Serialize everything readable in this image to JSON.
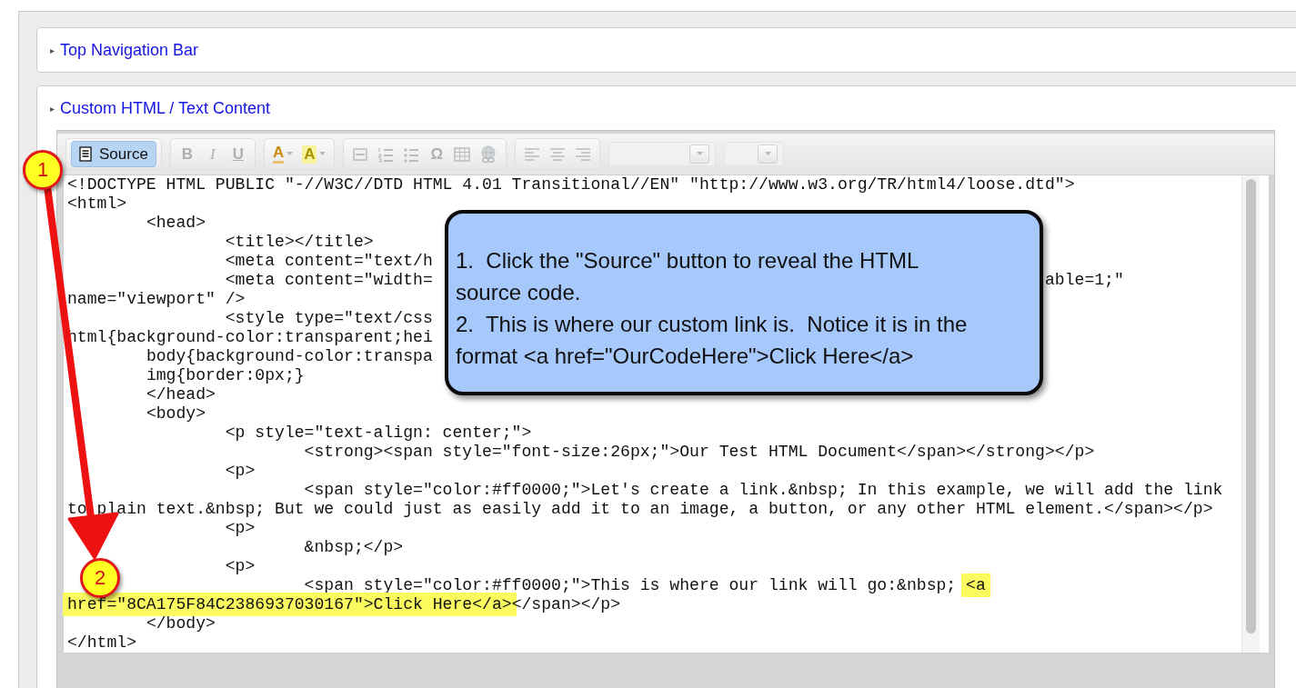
{
  "panels": [
    {
      "title": "Top Navigation Bar",
      "expander": "▸"
    },
    {
      "title": "Custom HTML / Text Content",
      "expander": "▸"
    }
  ],
  "editor": {
    "toolbar": [
      [
        {
          "kind": "source",
          "label": "Source",
          "on": true,
          "disabled": false
        }
      ],
      [
        {
          "kind": "bold",
          "label": "B",
          "on": false,
          "disabled": true
        },
        {
          "kind": "italic",
          "label": "I",
          "on": false,
          "disabled": true
        },
        {
          "kind": "underline",
          "label": "U",
          "on": false,
          "disabled": true
        }
      ],
      [
        {
          "kind": "text-color",
          "label": "A",
          "on": false,
          "disabled": true
        },
        {
          "kind": "bg-color",
          "label": "A",
          "on": false,
          "disabled": true
        }
      ],
      [
        {
          "kind": "rule",
          "on": false,
          "disabled": true
        },
        {
          "kind": "numbered-list",
          "on": false,
          "disabled": true
        },
        {
          "kind": "bullet-list",
          "on": false,
          "disabled": true
        },
        {
          "kind": "symbol",
          "label": "Ω",
          "on": false,
          "disabled": true
        },
        {
          "kind": "table",
          "on": false,
          "disabled": true
        },
        {
          "kind": "globe",
          "on": false,
          "disabled": true
        }
      ],
      [
        {
          "kind": "align-left",
          "on": false,
          "disabled": true
        },
        {
          "kind": "align-center",
          "on": false,
          "disabled": true
        },
        {
          "kind": "align-right",
          "on": false,
          "disabled": true
        }
      ],
      [
        {
          "kind": "dropdown",
          "on": false,
          "disabled": true
        }
      ],
      [
        {
          "kind": "small-dropdown",
          "on": false,
          "disabled": true
        }
      ]
    ],
    "code": [
      {
        "segments": [
          {
            "text": "<!DOCTYPE HTML PUBLIC \"-//W3C//DTD HTML 4.01 Transitional//EN\" \"http://www.w3.org/TR/html4/loose.dtd\">",
            "highlighted": false
          }
        ]
      },
      {
        "segments": [
          {
            "text": "<html>",
            "highlighted": false
          }
        ]
      },
      {
        "segments": [
          {
            "text": "\t<head>",
            "highlighted": false
          }
        ]
      },
      {
        "segments": [
          {
            "text": "\t\t<title></title>",
            "highlighted": false
          }
        ]
      },
      {
        "segments": [
          {
            "text": "\t\t<meta content=\"text/h",
            "highlighted": false
          }
        ]
      },
      {
        "segments": [
          {
            "text": "\t\t<meta content=\"width=",
            "highlighted": false
          }
        ],
        "tail": "able=1;\""
      },
      {
        "segments": [
          {
            "text": "name=\"viewport\" />",
            "highlighted": false
          }
        ]
      },
      {
        "segments": [
          {
            "text": "\t\t<style type=\"text/css",
            "highlighted": false
          }
        ]
      },
      {
        "segments": [
          {
            "text": "html{background-color:transparent;hei",
            "highlighted": false
          }
        ]
      },
      {
        "segments": [
          {
            "text": "\tbody{background-color:transpa",
            "highlighted": false
          }
        ]
      },
      {
        "segments": [
          {
            "text": "\timg{border:0px;}",
            "highlighted": false
          }
        ]
      },
      {
        "segments": [
          {
            "text": "\t</head>",
            "highlighted": false
          }
        ]
      },
      {
        "segments": [
          {
            "text": "\t<body>",
            "highlighted": false
          }
        ]
      },
      {
        "segments": [
          {
            "text": "\t\t<p style=\"text-align: center;\">",
            "highlighted": false
          }
        ]
      },
      {
        "segments": [
          {
            "text": "\t\t\t<strong><span style=\"font-size:26px;\">Our Test HTML Document</span></strong></p>",
            "highlighted": false
          }
        ]
      },
      {
        "segments": [
          {
            "text": "\t\t<p>",
            "highlighted": false
          }
        ]
      },
      {
        "segments": [
          {
            "text": "\t\t\t<span style=\"color:#ff0000;\">Let's create a link.&nbsp; In this example, we will add the link",
            "highlighted": false
          }
        ]
      },
      {
        "segments": [
          {
            "text": "to plain text.&nbsp; But we could just as easily add it to an image, a button, or any other HTML element.</span></p>",
            "highlighted": false
          }
        ]
      },
      {
        "segments": [
          {
            "text": "\t\t<p>",
            "highlighted": false
          }
        ]
      },
      {
        "segments": [
          {
            "text": "\t\t\t&nbsp;</p>",
            "highlighted": false
          }
        ]
      },
      {
        "segments": [
          {
            "text": "\t\t<p>",
            "highlighted": false
          }
        ]
      },
      {
        "segments": [
          {
            "text": "\t\t\t<span style=\"color:#ff0000;\">This is where our link will go:&nbsp; ",
            "highlighted": false
          },
          {
            "text": "<a",
            "highlighted": true
          }
        ]
      },
      {
        "segments": [
          {
            "text": "href=\"8CA175F84C2386937030167\">Click Here</a>",
            "highlighted": true
          },
          {
            "text": "</span></p>",
            "highlighted": false
          }
        ]
      },
      {
        "segments": [
          {
            "text": "\t</body>",
            "highlighted": false
          }
        ]
      },
      {
        "segments": [
          {
            "text": "</html>",
            "highlighted": false
          }
        ]
      }
    ]
  },
  "callout": {
    "paragraphs": [
      "1.  Click the \"Source\" button to reveal the HTML source code.",
      "2.  This is where our custom link is.  Notice it is in the format <a href=\"OurCodeHere\">Click Here</a>"
    ]
  },
  "markers": [
    "1",
    "2"
  ]
}
